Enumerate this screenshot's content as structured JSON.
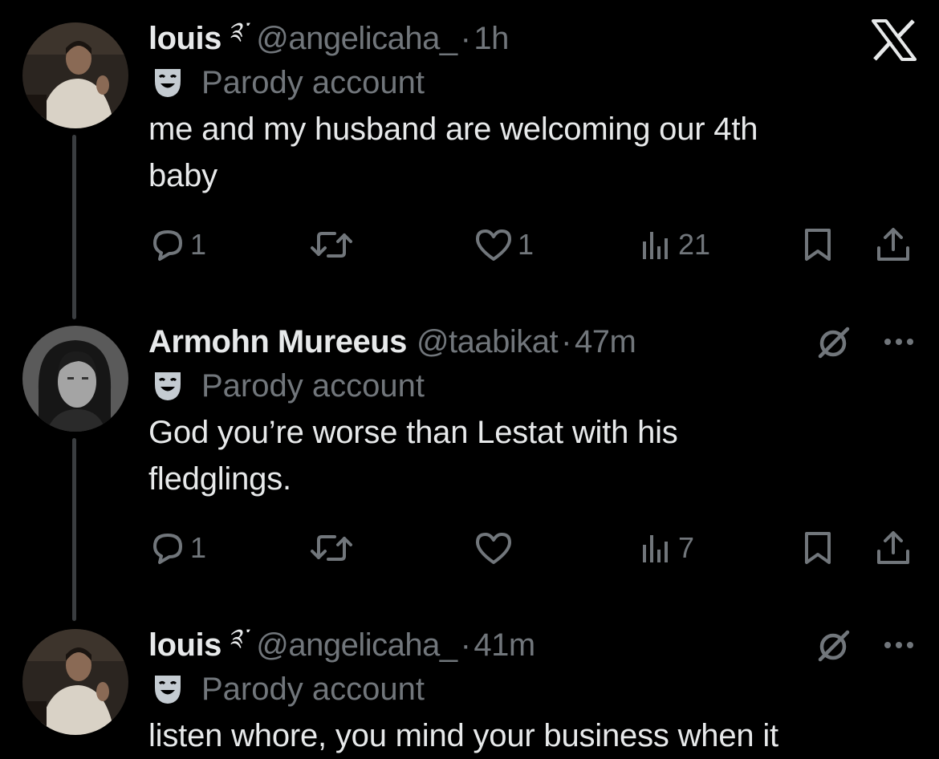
{
  "tweets": [
    {
      "display_name": "louis",
      "name_glyph": "༉་",
      "handle": "@angelicaha_",
      "separator": "·",
      "time": "1h",
      "badge": "Parody account",
      "text": "me and my husband are welcoming our 4th\nbaby",
      "replies": "1",
      "retweets": "",
      "likes": "1",
      "views": "21"
    },
    {
      "display_name": "Armohn Mureeus",
      "handle": "@taabikat",
      "separator": "·",
      "time": "47m",
      "badge": "Parody account",
      "text": "God you’re worse than Lestat with his\nfledglings.",
      "replies": "1",
      "retweets": "",
      "likes": "",
      "views": "7"
    },
    {
      "display_name": "louis",
      "name_glyph": "༉་",
      "handle": "@angelicaha_",
      "separator": "·",
      "time": "41m",
      "badge": "Parody account",
      "text": "listen whore, you mind your business when it"
    }
  ],
  "icons": {
    "close": "x-logo-icon",
    "grok": "grok-icon",
    "more": "more-icon",
    "reply": "reply-icon",
    "retweet": "retweet-icon",
    "like": "heart-icon",
    "views": "views-icon",
    "bookmark": "bookmark-icon",
    "share": "share-icon",
    "parody": "parody-mask-icon"
  },
  "colors": {
    "background": "#000000",
    "primary_text": "#e7e9ea",
    "secondary_text": "#71767b",
    "thread_line": "#3a3d40"
  }
}
